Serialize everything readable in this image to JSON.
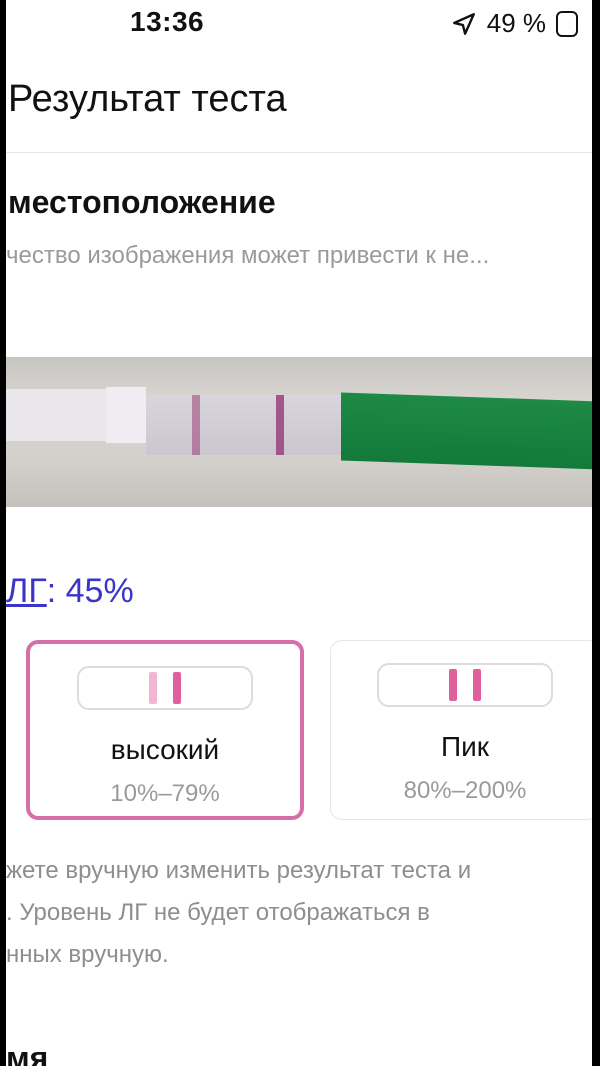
{
  "status": {
    "time": "13:36",
    "battery": "49 %"
  },
  "header": {
    "title": "Результат теста"
  },
  "section": {
    "title": "местоположение",
    "subtitle": "чество изображения может привести к не..."
  },
  "result": {
    "lh_label": "ЛГ",
    "lh_value": ": 45%"
  },
  "cards": [
    {
      "label": "высокий",
      "range": "10%–79%",
      "selected": true
    },
    {
      "label": "Пик",
      "range": "80%–200%",
      "selected": false
    }
  ],
  "note": {
    "line1": "жете вручную изменить результат теста и",
    "line2": ". Уровень ЛГ не будет отображаться в",
    "line3": "нных вручную."
  },
  "bottom": {
    "title": "мя"
  },
  "colors": {
    "accent_pink": "#d66fa8",
    "link_blue": "#3b34c9",
    "strip_line": "#e0609f",
    "strip_line_light": "#f2b6d2"
  },
  "icons": [
    "location-arrow-icon",
    "battery-icon"
  ]
}
